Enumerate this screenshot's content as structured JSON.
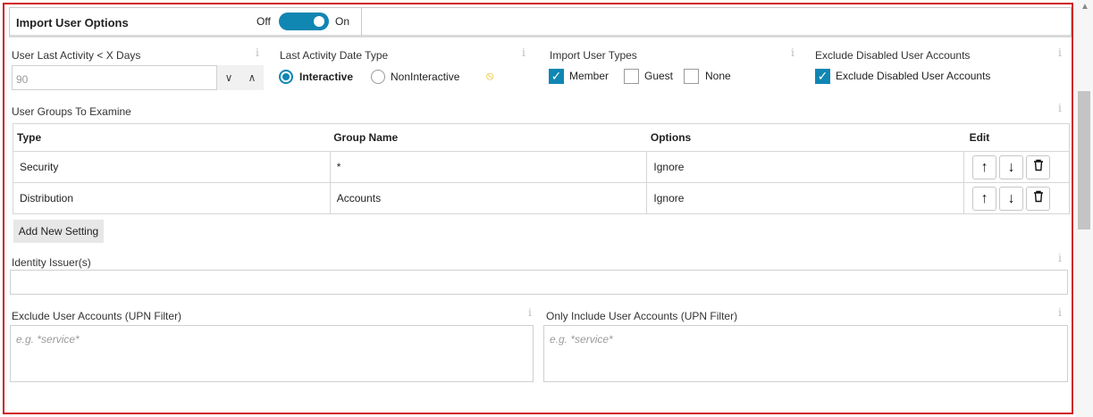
{
  "header": {
    "title": "Import User Options",
    "toggle_off": "Off",
    "toggle_on": "On"
  },
  "last_activity": {
    "label": "User Last Activity < X Days",
    "value": "90"
  },
  "activity_type": {
    "label": "Last Activity Date Type",
    "options": [
      "Interactive",
      "NonInteractive"
    ],
    "selected": "Interactive"
  },
  "user_types": {
    "label": "Import User Types",
    "options": [
      {
        "label": "Member",
        "checked": true
      },
      {
        "label": "Guest",
        "checked": false
      },
      {
        "label": "None",
        "checked": false
      }
    ]
  },
  "exclude_disabled": {
    "label": "Exclude Disabled User Accounts",
    "checkbox_label": "Exclude Disabled User Accounts",
    "checked": true
  },
  "groups": {
    "label": "User Groups To Examine",
    "columns": [
      "Type",
      "Group Name",
      "Options",
      "Edit"
    ],
    "rows": [
      {
        "type": "Security",
        "group_name": "*",
        "options": "Ignore"
      },
      {
        "type": "Distribution",
        "group_name": "Accounts",
        "options": "Ignore"
      }
    ],
    "add_button": "Add New Setting"
  },
  "identity_issuer": {
    "label": "Identity Issuer(s)",
    "value": ""
  },
  "exclude_upn": {
    "label": "Exclude User Accounts (UPN Filter)",
    "placeholder": "e.g. *service*"
  },
  "include_upn": {
    "label": "Only Include User Accounts (UPN Filter)",
    "placeholder": "e.g. *service*"
  },
  "icons": {
    "info": "info-icon",
    "up": "arrow-up-icon",
    "down": "arrow-down-icon",
    "delete": "trash-icon",
    "spin_down": "chevron-down-icon",
    "spin_up": "chevron-up-icon",
    "reset": "ban-icon"
  },
  "colors": {
    "accent": "#1086b3",
    "frame_border": "#d0191a",
    "warning": "#e3b400"
  }
}
